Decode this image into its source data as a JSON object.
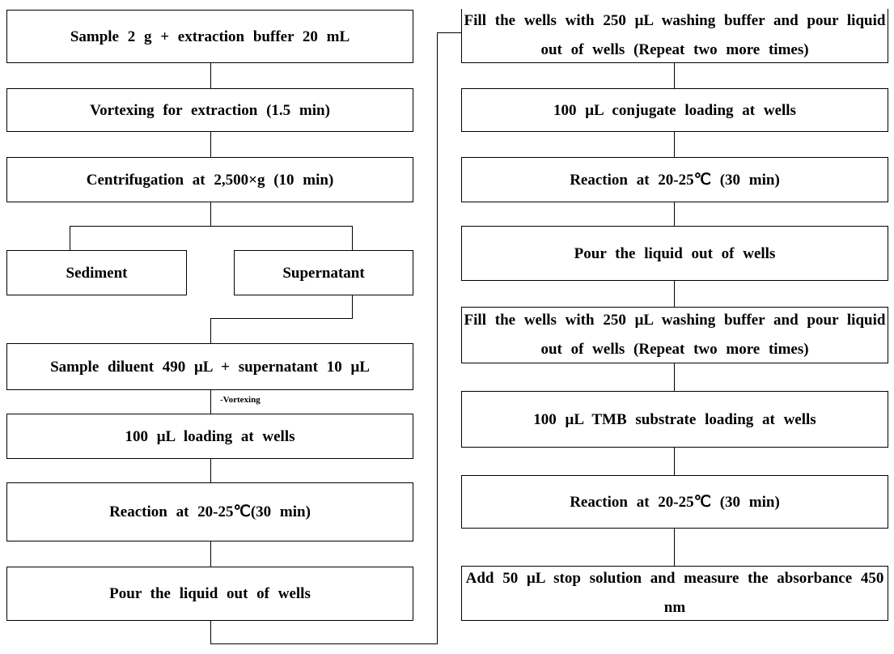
{
  "left_steps": [
    "Sample 2 g + extraction buffer 20 mL",
    "Vortexing for extraction (1.5 min)",
    "Centrifugation at 2,500×g (10 min)"
  ],
  "branch": {
    "sediment": "Sediment",
    "supernatant": "Supernatant"
  },
  "left_steps_2": [
    "Sample diluent 490 μL + supernatant 10 μL",
    "100 μL loading at wells",
    "Reaction at 20-25℃(30 min)",
    "Pour the liquid out of wells"
  ],
  "vortex_note": "-Vortexing",
  "right_steps": [
    "Fill the wells with 250 μL washing buffer and pour liquid out of wells (Repeat two more times)",
    "100 μL conjugate loading at wells",
    "Reaction at 20-25℃ (30 min)",
    "Pour the liquid out of wells",
    "Fill the wells with 250 μL washing buffer and pour liquid out of wells (Repeat two more times)",
    "100 μL TMB substrate loading at wells",
    "Reaction at 20-25℃ (30 min)",
    "Add 50 μL stop solution and measure the absorbance 450 nm"
  ]
}
